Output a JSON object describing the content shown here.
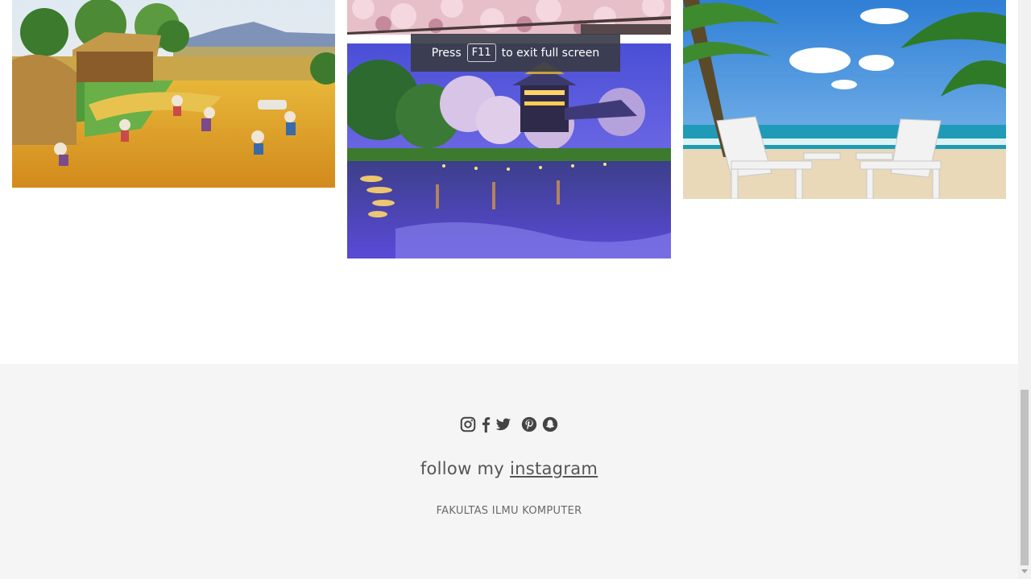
{
  "toast": {
    "prefix": "Press",
    "key": "F11",
    "suffix": "to exit full screen"
  },
  "gallery": {
    "images": [
      {
        "name": "farm-painting"
      },
      {
        "name": "cherry-blossom"
      },
      {
        "name": "castle-night-pond"
      },
      {
        "name": "beach-chairs"
      }
    ]
  },
  "footer": {
    "social_icons": [
      "instagram-icon",
      "facebook-icon",
      "twitter-icon",
      "pinterest-icon",
      "snapchat-icon"
    ],
    "follow_text": "follow my",
    "follow_link": "instagram",
    "faculty": "FAKULTAS ILMU KOMPUTER",
    "icon_color": "#444444",
    "background": "#f5f5f5"
  }
}
